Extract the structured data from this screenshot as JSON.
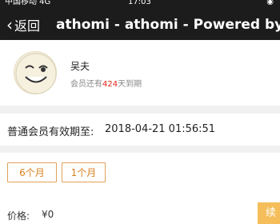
{
  "status_bar": {
    "carrier": "中国移动 4G",
    "time": "17:03",
    "battery": "◉"
  },
  "nav": {
    "back_label": "返回",
    "title": "athomi - athomi - Powered by W..."
  },
  "profile": {
    "name": "吴夫",
    "days_prefix": "会员还有",
    "days_value": "424",
    "days_suffix": "天到期"
  },
  "membership": {
    "label": "普通会员有效期至:",
    "value": "2018-04-21 01:56:51"
  },
  "options": [
    {
      "label": "6个月"
    },
    {
      "label": "1个月"
    }
  ],
  "price": {
    "label": "价格:",
    "value": "¥0"
  },
  "buy": {
    "label": "续"
  }
}
